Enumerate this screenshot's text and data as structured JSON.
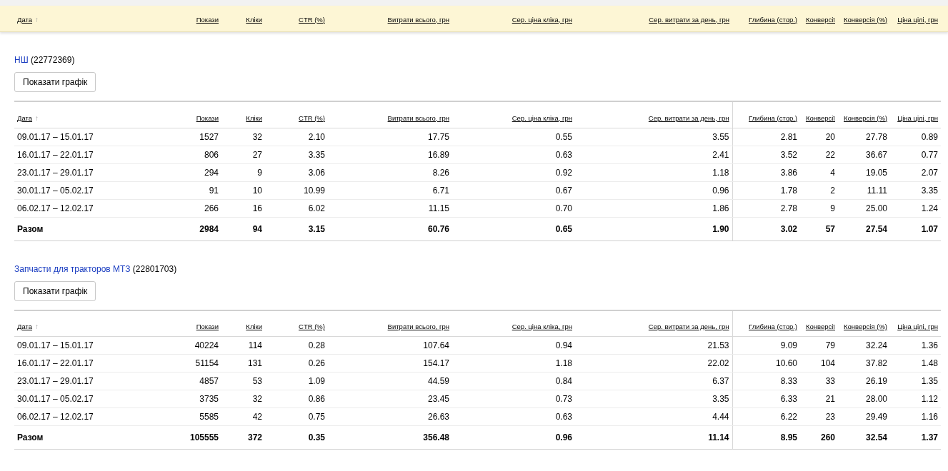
{
  "sticky_header": {
    "columns": [
      {
        "label": "Дата",
        "sort_indicator": "↑"
      },
      {
        "label": "Покази"
      },
      {
        "label": "Кліки"
      },
      {
        "label": "CTR (%)"
      },
      {
        "label": "Витрати всього, грн"
      },
      {
        "label": "Сер. ціна кліка, грн"
      },
      {
        "label": "Сер. витрати за день, грн"
      },
      {
        "label": "Глибина (стор.)"
      },
      {
        "label": "Конверсії"
      },
      {
        "label": "Конверсія (%)"
      },
      {
        "label": "Ціна цілі, грн"
      }
    ]
  },
  "sections": [
    {
      "name": "НШ",
      "id": "(22772369)",
      "button": "Показати графік",
      "columns": [
        {
          "label": "Дата",
          "sort_indicator": "↑"
        },
        {
          "label": "Покази"
        },
        {
          "label": "Кліки"
        },
        {
          "label": "CTR (%)"
        },
        {
          "label": "Витрати всього, грн"
        },
        {
          "label": "Сер. ціна кліка, грн"
        },
        {
          "label": "Сер. витрати за день, грн"
        },
        {
          "label": "Глибина (стор.)"
        },
        {
          "label": "Конверсії"
        },
        {
          "label": "Конверсія (%)"
        },
        {
          "label": "Ціна цілі, грн"
        }
      ],
      "rows": [
        [
          "09.01.17 – 15.01.17",
          "1527",
          "32",
          "2.10",
          "17.75",
          "0.55",
          "3.55",
          "2.81",
          "20",
          "27.78",
          "0.89"
        ],
        [
          "16.01.17 – 22.01.17",
          "806",
          "27",
          "3.35",
          "16.89",
          "0.63",
          "2.41",
          "3.52",
          "22",
          "36.67",
          "0.77"
        ],
        [
          "23.01.17 – 29.01.17",
          "294",
          "9",
          "3.06",
          "8.26",
          "0.92",
          "1.18",
          "3.86",
          "4",
          "19.05",
          "2.07"
        ],
        [
          "30.01.17 – 05.02.17",
          "91",
          "10",
          "10.99",
          "6.71",
          "0.67",
          "0.96",
          "1.78",
          "2",
          "11.11",
          "3.35"
        ],
        [
          "06.02.17 – 12.02.17",
          "266",
          "16",
          "6.02",
          "11.15",
          "0.70",
          "1.86",
          "2.78",
          "9",
          "25.00",
          "1.24"
        ]
      ],
      "total": [
        "Разом",
        "2984",
        "94",
        "3.15",
        "60.76",
        "0.65",
        "1.90",
        "3.02",
        "57",
        "27.54",
        "1.07"
      ]
    },
    {
      "name": "Запчасти для тракторов МТЗ",
      "id": "(22801703)",
      "button": "Показати графік",
      "columns": [
        {
          "label": "Дата",
          "sort_indicator": "↑"
        },
        {
          "label": "Покази"
        },
        {
          "label": "Кліки"
        },
        {
          "label": "CTR (%)"
        },
        {
          "label": "Витрати всього, грн"
        },
        {
          "label": "Сер. ціна кліка, грн"
        },
        {
          "label": "Сер. витрати за день, грн"
        },
        {
          "label": "Глибина (стор.)"
        },
        {
          "label": "Конверсії"
        },
        {
          "label": "Конверсія (%)"
        },
        {
          "label": "Ціна цілі, грн"
        }
      ],
      "rows": [
        [
          "09.01.17 – 15.01.17",
          "40224",
          "114",
          "0.28",
          "107.64",
          "0.94",
          "21.53",
          "9.09",
          "79",
          "32.24",
          "1.36"
        ],
        [
          "16.01.17 – 22.01.17",
          "51154",
          "131",
          "0.26",
          "154.17",
          "1.18",
          "22.02",
          "10.60",
          "104",
          "37.82",
          "1.48"
        ],
        [
          "23.01.17 – 29.01.17",
          "4857",
          "53",
          "1.09",
          "44.59",
          "0.84",
          "6.37",
          "8.33",
          "33",
          "26.19",
          "1.35"
        ],
        [
          "30.01.17 – 05.02.17",
          "3735",
          "32",
          "0.86",
          "23.45",
          "0.73",
          "3.35",
          "6.33",
          "21",
          "28.00",
          "1.12"
        ],
        [
          "06.02.17 – 12.02.17",
          "5585",
          "42",
          "0.75",
          "26.63",
          "0.63",
          "4.44",
          "6.22",
          "23",
          "29.49",
          "1.16"
        ]
      ],
      "total": [
        "Разом",
        "105555",
        "372",
        "0.35",
        "356.48",
        "0.96",
        "11.14",
        "8.95",
        "260",
        "32.54",
        "1.37"
      ]
    }
  ]
}
